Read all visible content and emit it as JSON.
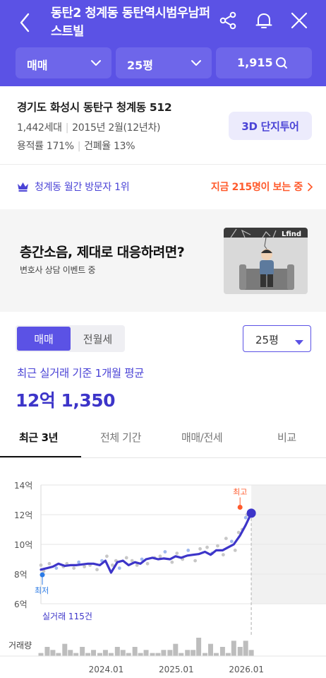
{
  "header": {
    "title": "동탄2 청계동 동탄역시범우남퍼스트빌",
    "icons": [
      "back-arrow-icon",
      "share-icon",
      "bell-icon",
      "close-icon"
    ],
    "filters": {
      "trade_type": "매매",
      "size": "25평",
      "listings_count": "1,915"
    },
    "colors": {
      "primary": "#5b52e5",
      "pill": "#6e66ea"
    }
  },
  "complex": {
    "address": "경기도 화성시 동탄구 청계동 512",
    "households": "1,442세대",
    "built": "2015년 2월(12년차)",
    "floor_area_ratio": "용적률 171%",
    "building_coverage": "건폐율 13%",
    "tour_button": "3D 단지투어"
  },
  "rank": {
    "label": "청계동 월간 방문자 1위",
    "viewers": "지금 215명이 보는 중",
    "colors": {
      "rank": "#4a43d6",
      "viewers": "#ff5a2c"
    }
  },
  "ad": {
    "title": "층간소음, 제대로 대응하려면?",
    "subtitle": "변호사 상담 이벤트 중",
    "image_brand": "Lfind"
  },
  "trade": {
    "segment": {
      "active": "매매",
      "inactive": "전월세"
    },
    "size_dropdown": "25평",
    "avg_label": "최근 실거래 기준 1개월 평균",
    "avg_price": "12억 1,350"
  },
  "tabs": {
    "items": [
      "최근 3년",
      "전체 기간",
      "매매/전세",
      "비교"
    ],
    "active_index": 0
  },
  "chart_data": {
    "type": "line",
    "y_tick_labels": [
      "14억",
      "12억",
      "10억",
      "8억",
      "6억"
    ],
    "ylim": [
      6,
      14
    ],
    "x_tick_labels": [
      "2024.01",
      "2025.01",
      "2026.01"
    ],
    "xlim": [
      2023.08,
      2026.3
    ],
    "high_label": "최고",
    "low_label": "최저",
    "transactions_label": "실거래 115건",
    "volume_label": "거래량",
    "series": [
      {
        "x": [
          2023.08,
          2023.17,
          2023.25,
          2023.33,
          2023.42,
          2023.5,
          2023.58,
          2023.67,
          2023.75,
          2023.83,
          2023.92,
          2024.0,
          2024.08,
          2024.17,
          2024.25,
          2024.33,
          2024.42,
          2024.5,
          2024.58,
          2024.67,
          2024.75,
          2024.83,
          2024.92,
          2025.0,
          2025.08,
          2025.17,
          2025.25,
          2025.33,
          2025.42,
          2025.5,
          2025.58,
          2025.67,
          2025.75,
          2025.83,
          2025.92,
          2026.0,
          2026.08
        ],
        "values": [
          8.3,
          8.4,
          8.5,
          8.7,
          8.55,
          8.6,
          8.6,
          8.65,
          8.7,
          8.7,
          8.6,
          8.9,
          8.1,
          8.8,
          8.9,
          8.6,
          8.8,
          8.7,
          9.0,
          9.1,
          9.0,
          9.05,
          9.0,
          9.2,
          9.1,
          9.25,
          9.3,
          9.35,
          9.5,
          9.3,
          9.6,
          9.6,
          9.8,
          10.0,
          10.6,
          11.3,
          12.1
        ]
      }
    ],
    "scatter_points": {
      "x": [
        2023.08,
        2023.12,
        2023.2,
        2023.3,
        2023.4,
        2023.45,
        2023.55,
        2023.62,
        2023.7,
        2023.78,
        2023.88,
        2023.95,
        2024.02,
        2024.1,
        2024.15,
        2024.2,
        2024.3,
        2024.38,
        2024.45,
        2024.52,
        2024.6,
        2024.7,
        2024.78,
        2024.85,
        2024.95,
        2025.02,
        2025.1,
        2025.18,
        2025.28,
        2025.35,
        2025.45,
        2025.52,
        2025.6,
        2025.68,
        2025.72,
        2025.8,
        2025.85,
        2025.9,
        2025.95,
        2026.0,
        2026.02
      ],
      "values": [
        8.6,
        8.2,
        8.7,
        8.4,
        8.5,
        8.7,
        8.4,
        8.8,
        8.5,
        8.6,
        8.3,
        8.9,
        9.2,
        8.6,
        8.9,
        8.4,
        9.1,
        8.9,
        8.6,
        9.0,
        8.7,
        9.1,
        9.2,
        9.5,
        8.8,
        9.4,
        9.0,
        9.6,
        8.9,
        9.7,
        9.8,
        9.4,
        9.9,
        9.3,
        10.4,
        10.2,
        9.6,
        10.8,
        11.0,
        11.8,
        12.0
      ]
    },
    "high": {
      "x": 2026.0,
      "value": 12.5
    },
    "low": {
      "x": 2023.1,
      "value": 7.95
    },
    "current": {
      "x": 2026.08,
      "value": 12.1
    },
    "volume": {
      "x": [
        2023.08,
        2023.17,
        2023.25,
        2023.33,
        2023.42,
        2023.5,
        2023.58,
        2023.67,
        2023.75,
        2023.83,
        2023.92,
        2024.0,
        2024.08,
        2024.17,
        2024.25,
        2024.33,
        2024.42,
        2024.5,
        2024.58,
        2024.67,
        2024.75,
        2024.83,
        2024.92,
        2025.0,
        2025.08,
        2025.17,
        2025.25,
        2025.33,
        2025.42,
        2025.5,
        2025.58,
        2025.67,
        2025.75,
        2025.83,
        2025.92,
        2026.0,
        2026.08
      ],
      "values": [
        1,
        3,
        2,
        1,
        4,
        2,
        1,
        3,
        1,
        2,
        1,
        2,
        1,
        3,
        2,
        1,
        3,
        1,
        2,
        1,
        1,
        2,
        2,
        4,
        1,
        2,
        2,
        6,
        1,
        4,
        1,
        3,
        1,
        5,
        3,
        5,
        2
      ]
    },
    "colors": {
      "line": "#3d35c9",
      "high": "#ff5a2c",
      "low": "#2c7be5",
      "scatter_gray": "#c7c7c7",
      "scatter_blue": "#9fb8ee",
      "volume": "#bdbdbd",
      "future_shade": "#f1f1f1"
    }
  }
}
